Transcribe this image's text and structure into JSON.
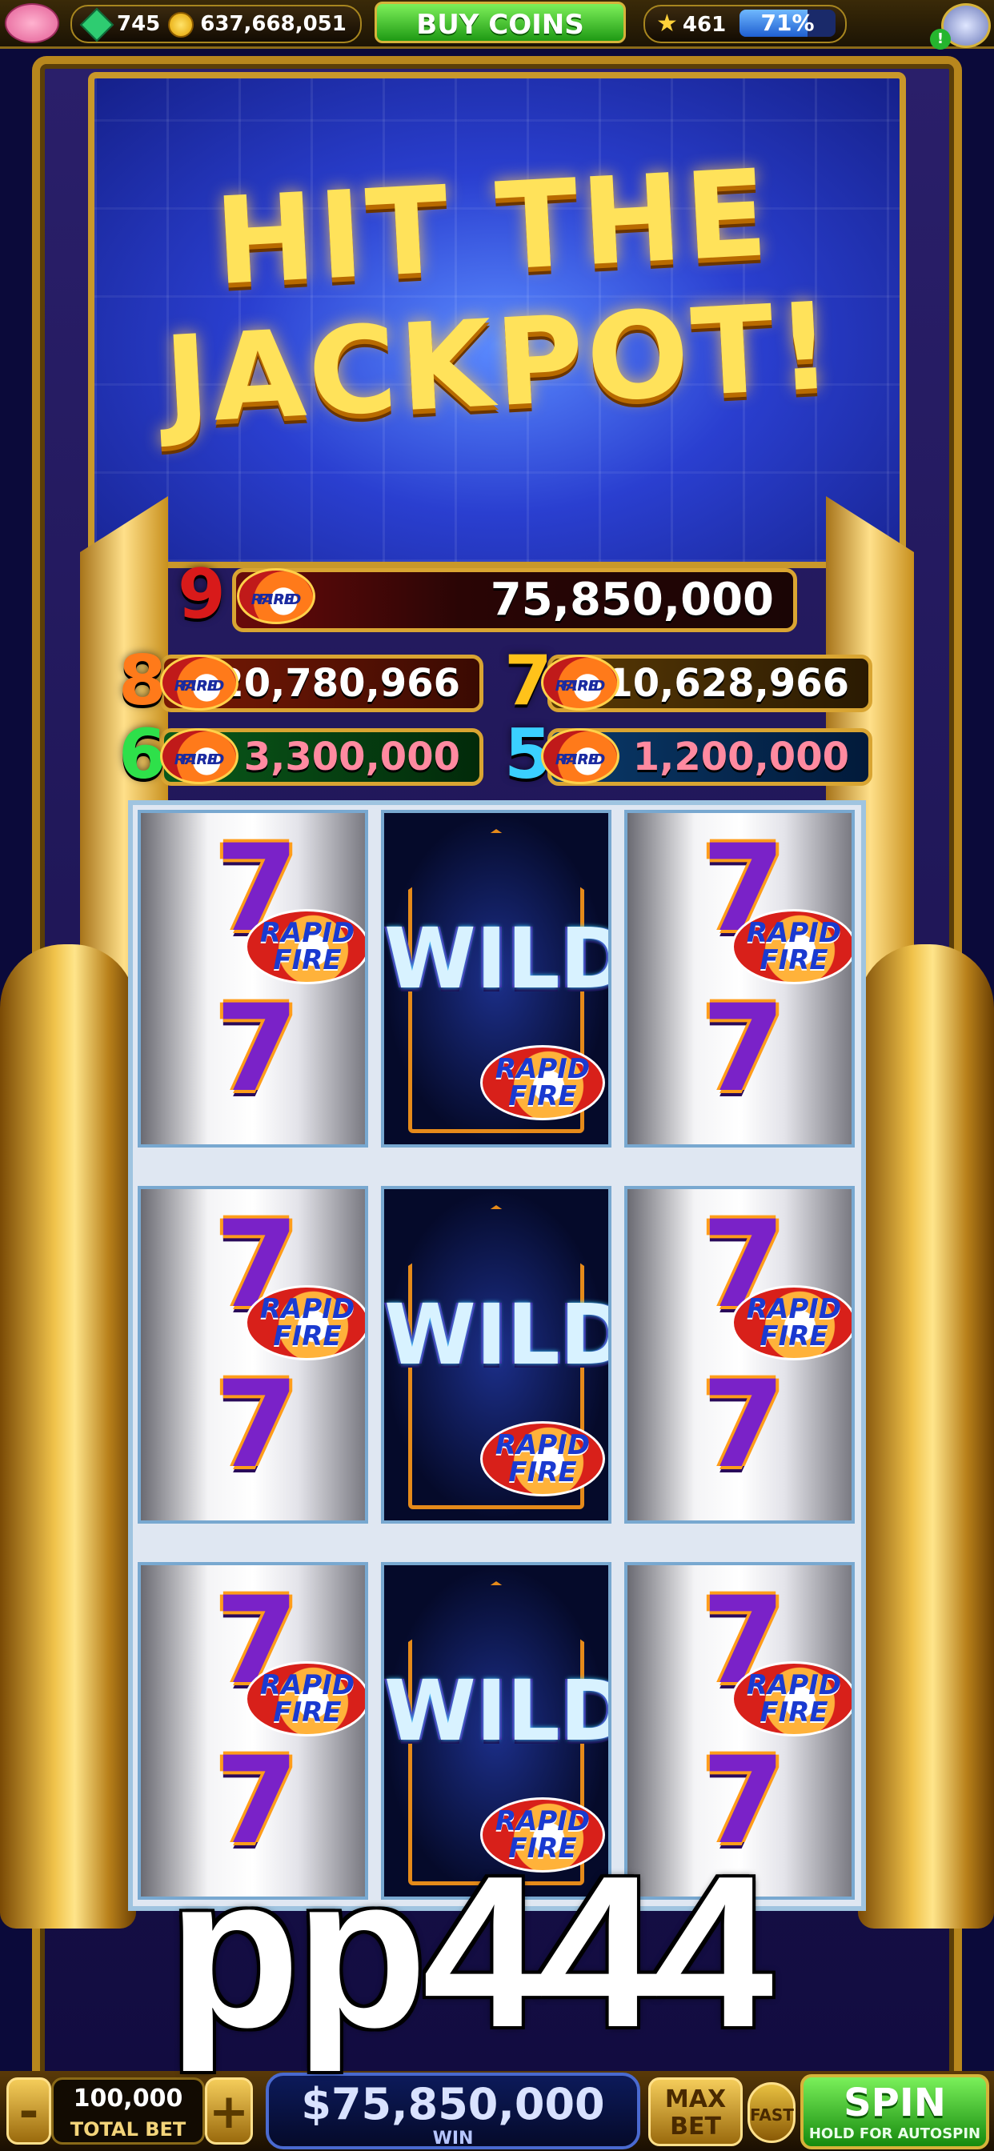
{
  "topbar": {
    "gems": "745",
    "coins": "637,668,051",
    "buy_label": "BUY COINS",
    "stars": "461",
    "level_percent_text": "71%",
    "level_progress": 0.71,
    "notification": "!"
  },
  "banner": {
    "title_line1": "HIT THE",
    "title_line2": "JACKPOT!"
  },
  "jackpots": {
    "nine": {
      "count": "9",
      "value": "75,850,000"
    },
    "eight": {
      "count": "8",
      "value": "20,780,966"
    },
    "seven": {
      "count": "7",
      "value": "10,628,966"
    },
    "six": {
      "count": "6",
      "value": "3,300,000"
    },
    "five": {
      "count": "5",
      "value": "1,200,000"
    }
  },
  "symbols": {
    "rapid": "RAPID",
    "fire": "FIRE",
    "wild": "WILD",
    "seven": "7"
  },
  "watermark": "pp444",
  "controls": {
    "minus": "-",
    "plus": "+",
    "total_bet_value": "100,000",
    "total_bet_label": "TOTAL BET",
    "win_value": "$75,850,000",
    "win_label": "WIN",
    "max_bet_line1": "MAX",
    "max_bet_line2": "BET",
    "fast_label": "FAST",
    "spin_label": "SPIN",
    "spin_sub": "HOLD FOR AUTOSPIN"
  },
  "colors": {
    "gold": "#d9a532",
    "spin_green": "#1f9a14",
    "seven_purple": "#7a22c8",
    "wild_blue": "#d8f2ff"
  }
}
